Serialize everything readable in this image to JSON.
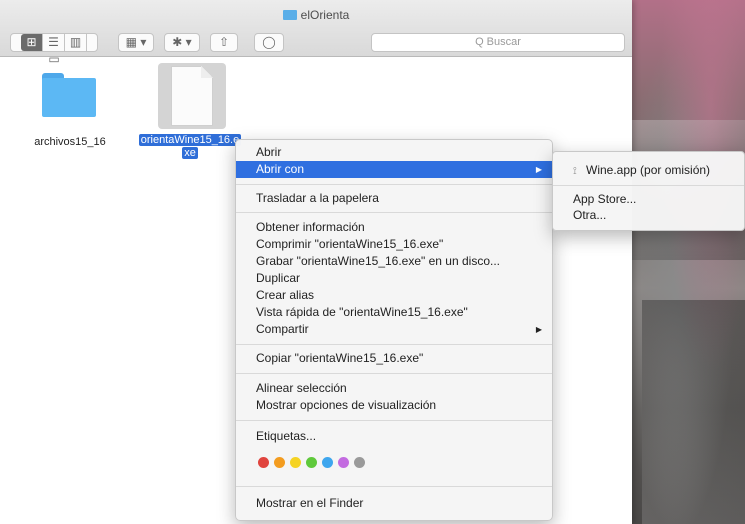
{
  "window": {
    "title": "elOrienta",
    "search_placeholder": "Q Buscar"
  },
  "toolbar": {
    "view_icons": [
      "⊞",
      "☰",
      "▥",
      "▭"
    ],
    "arrange_label": "▦ ▾",
    "action_label": "✱ ▾",
    "share_label": "⇧",
    "tags_label": "◯"
  },
  "files": {
    "folder_label": "archivos15_16",
    "exe_label_line1": "orientaWine15_16.e",
    "exe_label_line2": "xe"
  },
  "context_menu": {
    "items": [
      {
        "label": "Abrir"
      },
      {
        "label": "Abrir con",
        "highlighted": true,
        "arrow": "▶"
      },
      {
        "label": "Trasladar a la papelera"
      },
      {
        "label": "Obtener información"
      },
      {
        "label": "Comprimir \"orientaWine15_16.exe\""
      },
      {
        "label": "Grabar \"orientaWine15_16.exe\" en un disco..."
      },
      {
        "label": "Duplicar"
      },
      {
        "label": "Crear alias"
      },
      {
        "label": "Vista rápida de \"orientaWine15_16.exe\""
      },
      {
        "label": "Compartir",
        "arrow": "▶"
      },
      {
        "label": "Copiar \"orientaWine15_16.exe\""
      },
      {
        "label": "Alinear selección"
      },
      {
        "label": "Mostrar opciones de visualización"
      },
      {
        "label": "Etiquetas..."
      },
      {
        "label": "Mostrar en el Finder"
      }
    ],
    "tag_colors": [
      "#e0443e",
      "#f39c1f",
      "#f5d323",
      "#5fc93b",
      "#3ea6ee",
      "#c36be0",
      "#9a9a9a"
    ]
  },
  "submenu": {
    "items": [
      {
        "label": "Wine.app (por omisión)",
        "icon": "wine-icon"
      },
      {
        "label": "App Store..."
      },
      {
        "label": "Otra..."
      }
    ]
  }
}
